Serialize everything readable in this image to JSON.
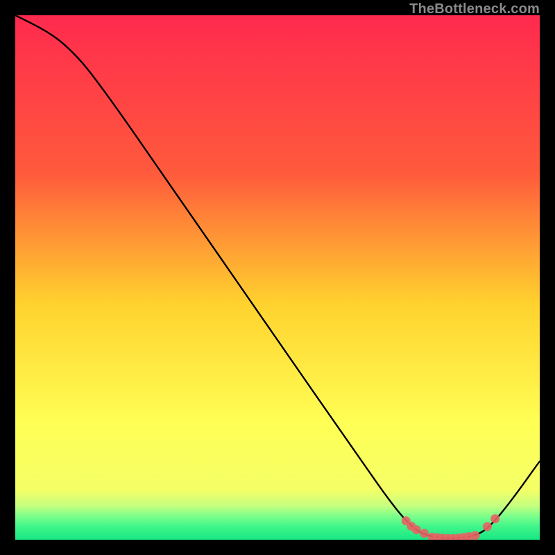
{
  "watermark": "TheBottleneck.com",
  "colors": {
    "frame": "#000000",
    "line": "#000000",
    "marker": "#e86363",
    "gradient_top": "#ff2a4e",
    "gradient_mid_hi": "#ff7a3a",
    "gradient_mid": "#ffd22e",
    "gradient_mid_lo": "#f7ff4a",
    "gradient_low": "#d8ff7a",
    "gradient_green_hi": "#7dff8a",
    "gradient_green_lo": "#18e884"
  },
  "chart_data": {
    "type": "line",
    "title": "",
    "xlabel": "",
    "ylabel": "",
    "xlim": [
      0,
      100
    ],
    "ylim": [
      0,
      100
    ],
    "curve": [
      {
        "x": 0,
        "y": 100
      },
      {
        "x": 6,
        "y": 97
      },
      {
        "x": 10,
        "y": 94
      },
      {
        "x": 15,
        "y": 88.5
      },
      {
        "x": 30,
        "y": 67
      },
      {
        "x": 50,
        "y": 38
      },
      {
        "x": 65,
        "y": 16.5
      },
      {
        "x": 72,
        "y": 6.5
      },
      {
        "x": 76,
        "y": 2.0
      },
      {
        "x": 79,
        "y": 0.6
      },
      {
        "x": 83,
        "y": 0.2
      },
      {
        "x": 88,
        "y": 0.7
      },
      {
        "x": 91,
        "y": 3.0
      },
      {
        "x": 95,
        "y": 8.0
      },
      {
        "x": 100,
        "y": 15.0
      }
    ],
    "markers": [
      {
        "x": 74.5,
        "y": 3.6
      },
      {
        "x": 75.5,
        "y": 2.6
      },
      {
        "x": 76.5,
        "y": 1.9
      },
      {
        "x": 78.0,
        "y": 1.2
      },
      {
        "x": 79.5,
        "y": 0.5
      },
      {
        "x": 80.5,
        "y": 0.4
      },
      {
        "x": 81.5,
        "y": 0.3
      },
      {
        "x": 82.5,
        "y": 0.25
      },
      {
        "x": 83.5,
        "y": 0.25
      },
      {
        "x": 84.5,
        "y": 0.3
      },
      {
        "x": 85.5,
        "y": 0.45
      },
      {
        "x": 86.5,
        "y": 0.6
      },
      {
        "x": 87.7,
        "y": 0.8
      },
      {
        "x": 90.0,
        "y": 2.5
      },
      {
        "x": 91.5,
        "y": 4.0
      }
    ]
  }
}
